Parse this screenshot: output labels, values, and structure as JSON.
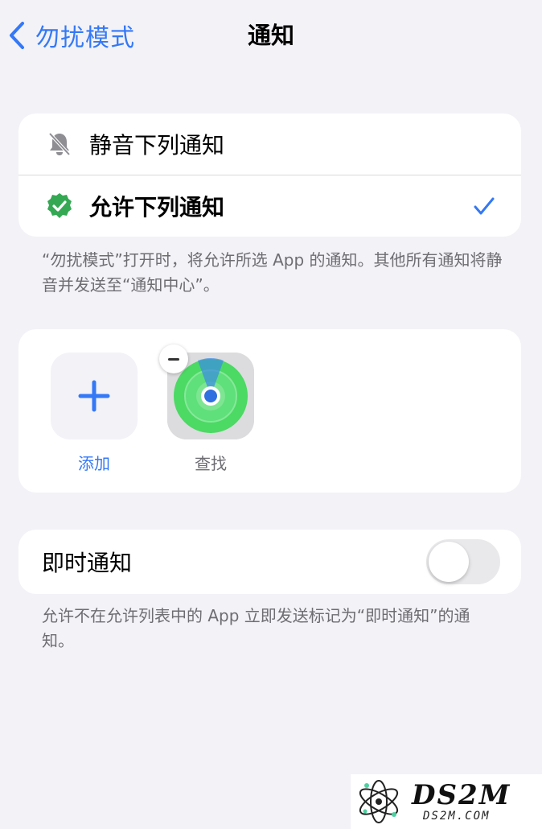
{
  "nav": {
    "back_label": "勿扰模式",
    "title": "通知"
  },
  "mode_options": [
    {
      "label": "静音下列通知",
      "icon": "bell-slash-icon",
      "selected": false
    },
    {
      "label": "允许下列通知",
      "icon": "check-seal-icon",
      "selected": true
    }
  ],
  "mode_footnote": "“勿扰模式”打开时，将允许所选 App 的通知。其他所有通知将静音并发送至“通知中心”。",
  "apps": {
    "add_label": "添加",
    "items": [
      {
        "label": "查找",
        "icon": "find-my-icon"
      }
    ]
  },
  "time_sensitive": {
    "label": "即时通知",
    "enabled": false,
    "footnote": "允许不在允许列表中的 App 立即发送标记为“即时通知”的通知。"
  },
  "watermark": {
    "big": "DS2M",
    "small": "DS2M.COM"
  },
  "colors": {
    "accent": "#3478f6",
    "background": "#f2f2f7",
    "card": "#ffffff",
    "secondary_text": "#6d6d72",
    "check_seal": "#34a853",
    "find_my_green": "#4cd964"
  }
}
